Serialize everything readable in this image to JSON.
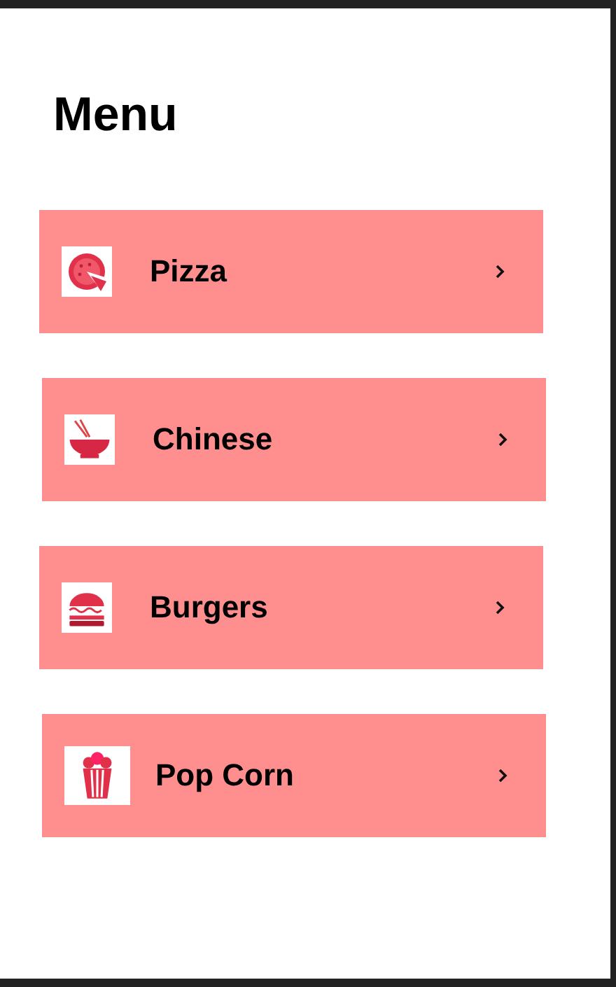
{
  "title": "Menu",
  "items": [
    {
      "label": "Pizza",
      "kind": "pizza"
    },
    {
      "label": "Chinese",
      "kind": "bowl"
    },
    {
      "label": "Burgers",
      "kind": "burger"
    },
    {
      "label": "Pop Corn",
      "kind": "popcorn"
    }
  ]
}
